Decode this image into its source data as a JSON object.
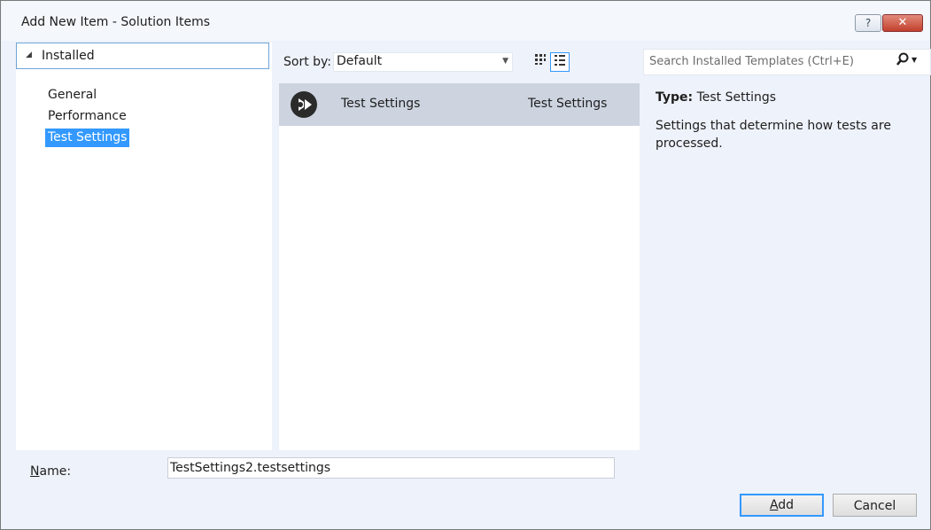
{
  "window": {
    "title": "Add New Item - Solution Items",
    "help_glyph": "?",
    "close_glyph": "✕"
  },
  "sidebar": {
    "header": "Installed",
    "items": [
      {
        "label": "General",
        "selected": false
      },
      {
        "label": "Performance",
        "selected": false
      },
      {
        "label": "Test Settings",
        "selected": true
      }
    ]
  },
  "toolbar": {
    "sort_label": "Sort by:",
    "sort_value": "Default",
    "search_placeholder": "Search Installed Templates (Ctrl+E)"
  },
  "templates": [
    {
      "name": "Test Settings",
      "type": "Test Settings",
      "icon": "test-settings-icon",
      "selected": true
    }
  ],
  "details": {
    "type_label": "Type:",
    "type_value": "Test Settings",
    "description": "Settings that determine how tests are processed."
  },
  "footer": {
    "name_label_accel": "N",
    "name_label_rest": "ame:",
    "name_value": "TestSettings2.testsettings",
    "add_accel": "A",
    "add_rest": "dd",
    "cancel_label": "Cancel"
  },
  "colors": {
    "selection": "#3399ff",
    "row_selected": "#cdd4e0",
    "close_button": "#c2402c"
  }
}
